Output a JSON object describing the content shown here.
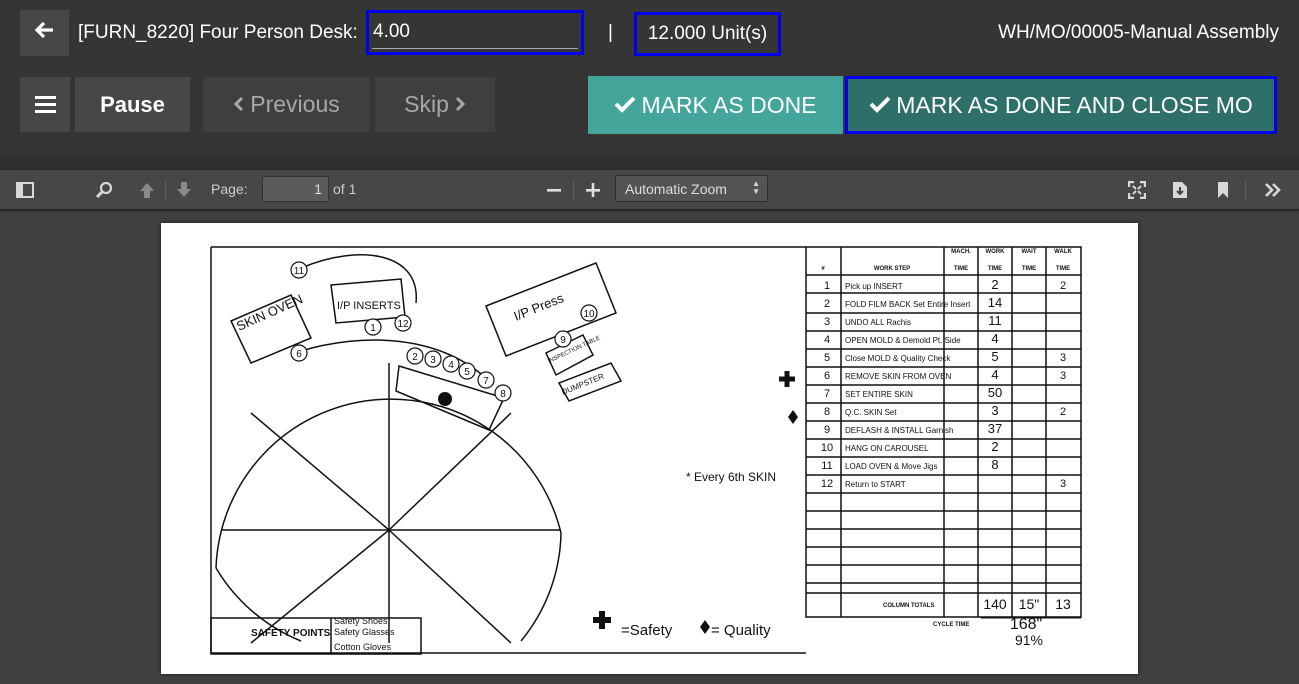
{
  "header": {
    "work_order_title": "[FURN_8220] Four Person Desk:",
    "quantity_value": "4.00",
    "separator": "|",
    "units": "12.000 Unit(s)",
    "mo_reference": "WH/MO/00005-Manual Assembly"
  },
  "actions": {
    "pause_label": "Pause",
    "previous_label": "Previous",
    "skip_label": "Skip",
    "mark_done_label": "MARK AS DONE",
    "mark_done_close_label": "MARK AS DONE AND CLOSE MO"
  },
  "pdf_toolbar": {
    "page_label": "Page:",
    "page_number": "1",
    "page_of": "of 1",
    "zoom_value": "Automatic Zoom"
  },
  "document": {
    "skin_oven": "SKIN OVEN",
    "ip_inserts": "I/P INSERTS",
    "ip_press": "I/P Press",
    "inspection_table": "INSPECTION TABLE",
    "dumpster": "DUMPSTER",
    "safety_points_label": "SAFETY POINTS",
    "safety_points_items": [
      "Safety Shoes",
      "Safety Glasses",
      "Cotton Gloves"
    ],
    "legend_safety": "=Safety",
    "legend_quality": "= Quality",
    "every_note": "* Every 6th SKIN",
    "table_headers": {
      "num": "#",
      "work_step": "WORK STEP",
      "mach": "MACH.",
      "work": "WORK",
      "wait": "WAIT",
      "walk": "WALK",
      "time": "TIME"
    },
    "steps": [
      {
        "n": "1",
        "step": "Pick up INSERT",
        "work": "2",
        "walk": "2"
      },
      {
        "n": "2",
        "step": "FOLD FILM BACK Set Entire Insert",
        "work": "14",
        "walk": ""
      },
      {
        "n": "3",
        "step": "UNDO ALL Rachis",
        "work": "11",
        "walk": ""
      },
      {
        "n": "4",
        "step": "OPEN MOLD & Demold Pt. Side",
        "work": "4",
        "walk": ""
      },
      {
        "n": "5",
        "step": "Close MOLD & Quality Check",
        "work": "5",
        "walk": "3"
      },
      {
        "n": "6",
        "step": "REMOVE SKIN FROM OVEN",
        "work": "4",
        "walk": "3"
      },
      {
        "n": "7",
        "step": "SET ENTIRE SKIN",
        "work": "50",
        "walk": ""
      },
      {
        "n": "8",
        "step": "Q.C. SKIN Set",
        "work": "3",
        "walk": "2"
      },
      {
        "n": "9",
        "step": "DEFLASH & INSTALL Garnish",
        "work": "37",
        "walk": ""
      },
      {
        "n": "10",
        "step": "HANG ON CAROUSEL",
        "work": "2",
        "walk": ""
      },
      {
        "n": "11",
        "step": "LOAD OVEN & Move Jigs",
        "work": "8",
        "walk": ""
      },
      {
        "n": "12",
        "step": "Return to START",
        "work": "",
        "walk": "3"
      }
    ],
    "column_totals_label": "COLUMN TOTALS",
    "totals": {
      "work": "140",
      "wait": "15\"",
      "walk": "13"
    },
    "cycle_time_label": "CYCLE TIME",
    "cycle_time_value": "168\"",
    "cycle_percent": "91%"
  }
}
